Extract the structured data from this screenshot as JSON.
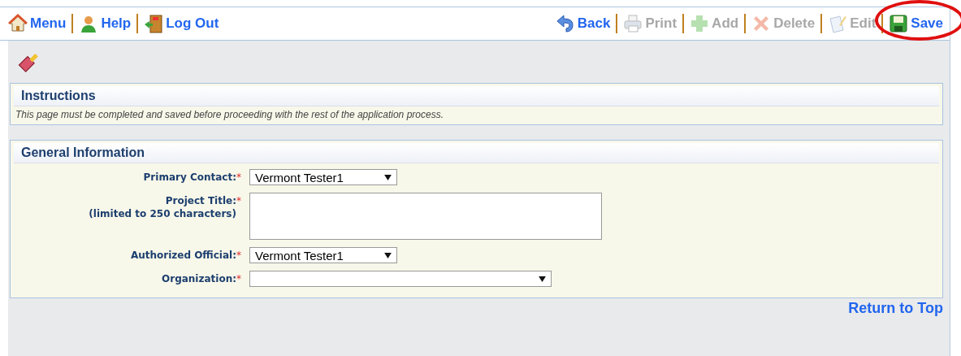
{
  "toolbar_left": [
    {
      "label": "Menu",
      "kind": "house",
      "disabled": false
    },
    {
      "label": "Help",
      "kind": "person",
      "disabled": false
    },
    {
      "label": "Log Out",
      "kind": "door",
      "disabled": false
    }
  ],
  "toolbar_right": [
    {
      "label": "Back",
      "kind": "back",
      "disabled": false
    },
    {
      "label": "Print",
      "kind": "printer",
      "disabled": true
    },
    {
      "label": "Add",
      "kind": "plus",
      "disabled": true
    },
    {
      "label": "Delete",
      "kind": "cross",
      "disabled": true
    },
    {
      "label": "Edit",
      "kind": "notepad",
      "disabled": true
    },
    {
      "label": "Save",
      "kind": "floppy",
      "disabled": false,
      "circled": true
    }
  ],
  "instructions": {
    "title": "Instructions",
    "text": "This page must be completed and saved before proceeding with the rest of the application process."
  },
  "general": {
    "title": "General Information",
    "fields": [
      {
        "label": "Primary Contact:",
        "required_mark": "*",
        "kind": "select",
        "value": "Vermont Tester1"
      },
      {
        "label": "Project Title:",
        "label_2": "(limited to 250 characters)",
        "required_mark": "*",
        "kind": "textarea"
      },
      {
        "label": "Authorized Official:",
        "required_mark": "*",
        "kind": "select",
        "value": "Vermont Tester1"
      },
      {
        "label": "Organization:",
        "required_mark": "*",
        "kind": "select"
      }
    ]
  },
  "return_link": "Return to Top"
}
